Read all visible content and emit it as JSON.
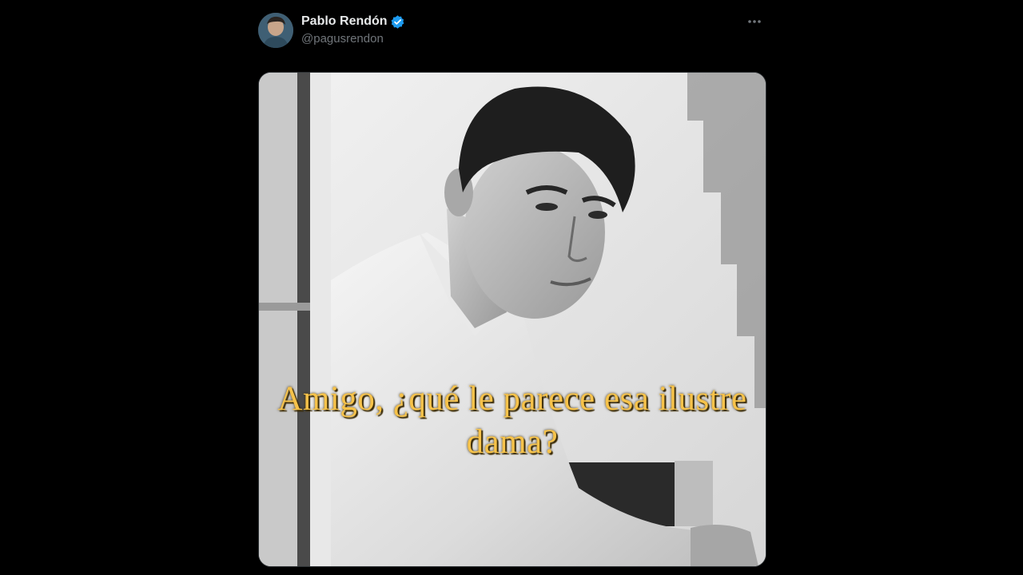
{
  "tweet": {
    "author": {
      "display_name": "Pablo Rendón",
      "handle": "@pagusrendon",
      "verified": true,
      "avatar_icon": "avatar-photo"
    },
    "more_icon": "more-horizontal-icon",
    "media": {
      "caption": "Amigo, ¿qué le parece esa ilustre dama?",
      "caption_color": "#f6c24a"
    }
  },
  "colors": {
    "background": "#000000",
    "name_text": "#e7e9ea",
    "handle_text": "#71767b",
    "verified_badge": "#1d9bf0"
  }
}
